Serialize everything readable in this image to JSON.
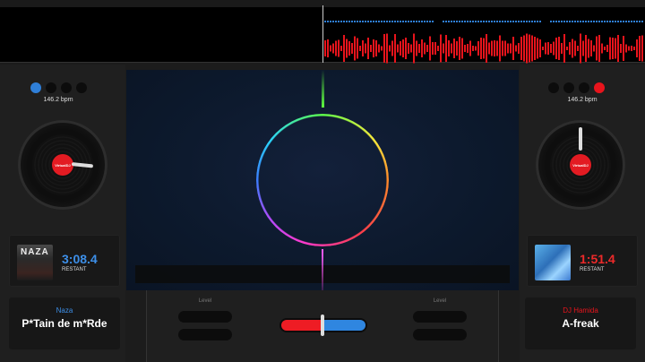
{
  "deck_left": {
    "bpm": "146.2 bpm",
    "time_remaining": "3:08.4",
    "remaining_label": "RESTANT",
    "cover_title": "NAZA",
    "platter_label": "VirtualDJ",
    "artist": "Naza",
    "title": "P*Tain de m*Rde",
    "accent": "#2f7fd8"
  },
  "deck_right": {
    "bpm": "146.2 bpm",
    "time_remaining": "1:51.4",
    "remaining_label": "RESTANT",
    "platter_label": "VirtualDJ",
    "artist": "DJ Hamida",
    "title": "A-freak",
    "accent": "#e8141c"
  },
  "mixer": {
    "level_left": "Level",
    "level_right": "Level",
    "crossfader_position": 0.5
  },
  "visualizer": {
    "type": "rainbow-ring"
  }
}
